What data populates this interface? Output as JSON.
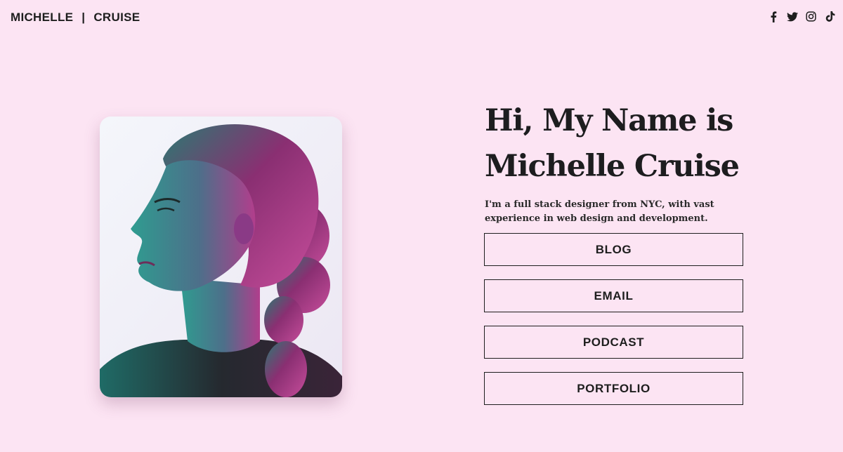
{
  "header": {
    "brand_first": "MICHELLE",
    "brand_separator": "|",
    "brand_last": "CRUISE",
    "socials": [
      {
        "icon": "facebook-icon"
      },
      {
        "icon": "twitter-icon"
      },
      {
        "icon": "instagram-icon"
      },
      {
        "icon": "tiktok-icon"
      }
    ]
  },
  "hero": {
    "heading_line1": "Hi, My Name is",
    "heading_line2": "Michelle Cruise",
    "description": "I'm a full stack designer from NYC, with vast experience in web design and development."
  },
  "buttons": [
    {
      "label": "BLOG"
    },
    {
      "label": "EMAIL"
    },
    {
      "label": "PODCAST"
    },
    {
      "label": "PORTFOLIO"
    }
  ],
  "colors": {
    "background": "#fce4f3",
    "text": "#1e1e1e",
    "photo_teal": "#2f8f86",
    "photo_magenta": "#b0307e"
  }
}
